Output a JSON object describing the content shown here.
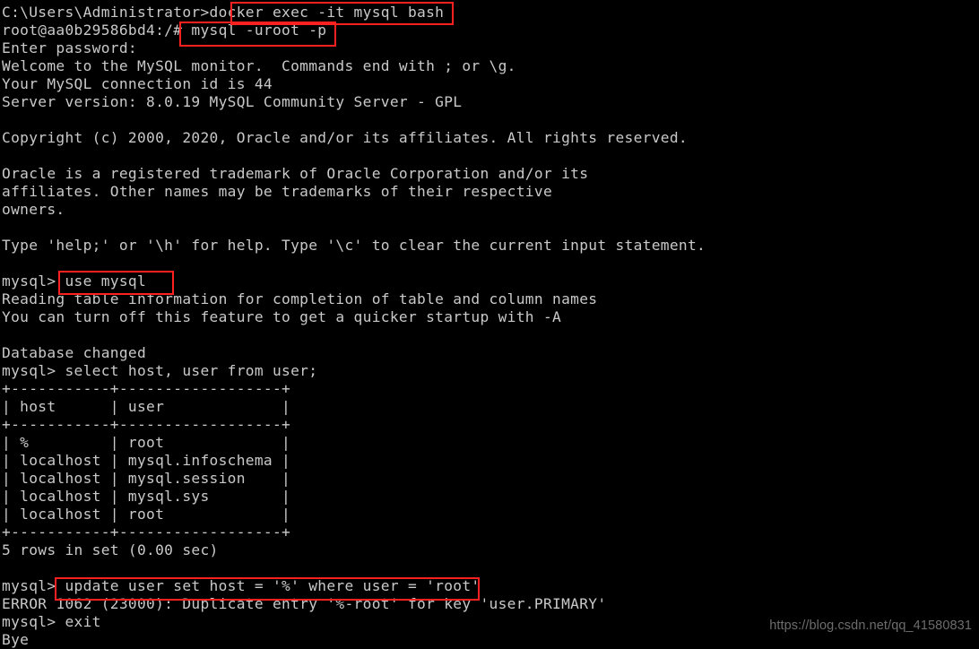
{
  "terminal": {
    "background_color": "#000000",
    "text_color": "#c9c9c9",
    "highlight_color": "#ff2020",
    "lines": [
      "C:\\Users\\Administrator>docker exec -it mysql bash",
      "root@aa0b29586bd4:/# mysql -uroot -p",
      "Enter password:",
      "Welcome to the MySQL monitor.  Commands end with ; or \\g.",
      "Your MySQL connection id is 44",
      "Server version: 8.0.19 MySQL Community Server - GPL",
      "",
      "Copyright (c) 2000, 2020, Oracle and/or its affiliates. All rights reserved.",
      "",
      "Oracle is a registered trademark of Oracle Corporation and/or its",
      "affiliates. Other names may be trademarks of their respective",
      "owners.",
      "",
      "Type 'help;' or '\\h' for help. Type '\\c' to clear the current input statement.",
      "",
      "mysql> use mysql",
      "Reading table information for completion of table and column names",
      "You can turn off this feature to get a quicker startup with -A",
      "",
      "Database changed",
      "mysql> select host, user from user;",
      "+-----------+------------------+",
      "| host      | user             |",
      "+-----------+------------------+",
      "| %         | root             |",
      "| localhost | mysql.infoschema |",
      "| localhost | mysql.session    |",
      "| localhost | mysql.sys        |",
      "| localhost | root             |",
      "+-----------+------------------+",
      "5 rows in set (0.00 sec)",
      "",
      "mysql> update user set host = '%' where user = 'root'",
      "ERROR 1062 (23000): Duplicate entry '%-root' for key 'user.PRIMARY'",
      "mysql> exit",
      "Bye"
    ],
    "highlights": [
      {
        "id": "box-docker",
        "label": "docker exec -it mysql bash"
      },
      {
        "id": "box-mysqlcmd",
        "label": "mysql -uroot -p"
      },
      {
        "id": "box-usemysql",
        "label": "use mysql"
      },
      {
        "id": "box-update",
        "label": "update user set host = '%' where user = 'root'"
      }
    ],
    "query_result": {
      "columns": [
        "host",
        "user"
      ],
      "rows": [
        [
          "%",
          "root"
        ],
        [
          "localhost",
          "mysql.infoschema"
        ],
        [
          "localhost",
          "mysql.session"
        ],
        [
          "localhost",
          "mysql.sys"
        ],
        [
          "localhost",
          "root"
        ]
      ],
      "row_count_text": "5 rows in set (0.00 sec)"
    }
  },
  "watermark": {
    "text": "https://blog.csdn.net/qq_41580831"
  }
}
